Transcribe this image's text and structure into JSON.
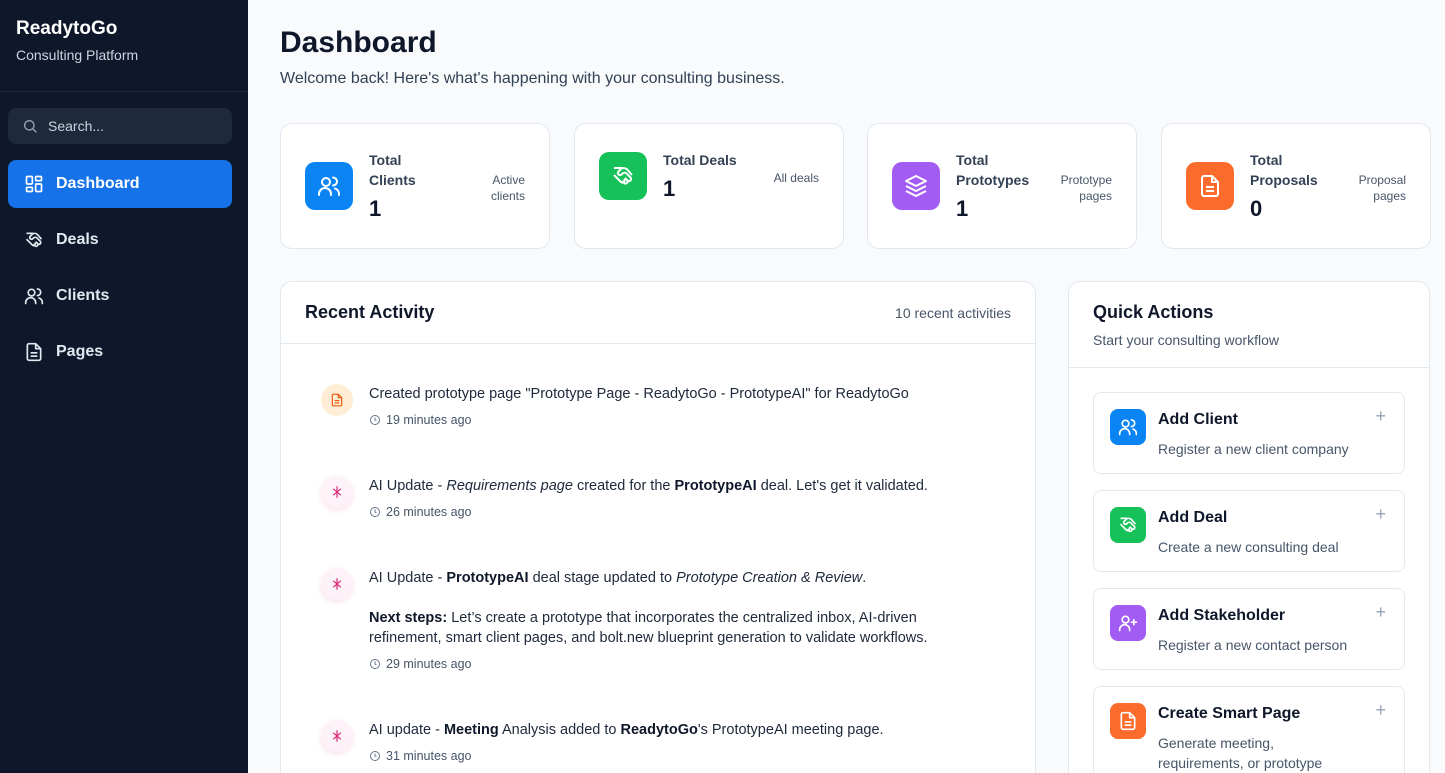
{
  "app": {
    "name": "ReadytoGo",
    "subtitle": "Consulting Platform"
  },
  "sidebar": {
    "search_placeholder": "Search...",
    "items": [
      {
        "label": "Dashboard",
        "icon": "dashboard-grid-icon",
        "active": true
      },
      {
        "label": "Deals",
        "icon": "handshake-icon"
      },
      {
        "label": "Clients",
        "icon": "users-icon"
      },
      {
        "label": "Pages",
        "icon": "document-icon"
      }
    ]
  },
  "header": {
    "title": "Dashboard",
    "subtitle": "Welcome back! Here's what's happening with your consulting business."
  },
  "stats": [
    {
      "label": "Total Clients",
      "value": "1",
      "desc": "Active clients",
      "icon": "users-icon",
      "color": "#0b84f3"
    },
    {
      "label": "Total Deals",
      "value": "1",
      "desc": "All deals",
      "icon": "handshake-icon",
      "color": "#16c15a"
    },
    {
      "label": "Total Prototypes",
      "value": "1",
      "desc": "Prototype pages",
      "icon": "layers-icon",
      "color": "#a25cf3"
    },
    {
      "label": "Total Proposals",
      "value": "0",
      "desc": "Proposal pages",
      "icon": "document-icon",
      "color": "#fb6c2c"
    }
  ],
  "recent": {
    "title": "Recent Activity",
    "count": "10 recent activities",
    "items": [
      {
        "icon": "document-icon",
        "text": "Created prototype page \"Prototype Page - ReadytoGo - PrototypeAI\" for ReadytoGo",
        "time": "19 minutes ago"
      },
      {
        "icon": "ai-sparkle-icon",
        "p1": "AI Update - ",
        "p2": "Requirements page",
        "p3": " created for the ",
        "p4": "PrototypeAI",
        "p5": " deal. Let's get it validated.",
        "time": "26 minutes ago"
      },
      {
        "icon": "ai-sparkle-icon",
        "p1": "AI Update - ",
        "p2": "PrototypeAI",
        "p3": " deal stage updated to ",
        "p4": "Prototype Creation & Review",
        "p5": ".",
        "next_label": "Next steps:",
        "next_text": " Let’s create a prototype that incorporates the centralized inbox, AI-driven refinement, smart client pages, and bolt.new blueprint generation to validate workflows.",
        "time": "29 minutes ago"
      },
      {
        "icon": "ai-sparkle-icon",
        "p1": "AI update - ",
        "p2": "Meeting",
        "p3": " Analysis added to ",
        "p4": "ReadytoGo",
        "p5": "'s PrototypeAI meeting page.",
        "time": "31 minutes ago"
      }
    ]
  },
  "quick": {
    "title": "Quick Actions",
    "subtitle": "Start your consulting workflow",
    "plus": "+",
    "items": [
      {
        "title": "Add Client",
        "desc": "Register a new client company",
        "icon": "users-icon",
        "color": "#0b84f3"
      },
      {
        "title": "Add Deal",
        "desc": "Create a new consulting deal",
        "icon": "handshake-icon",
        "color": "#16c15a"
      },
      {
        "title": "Add Stakeholder",
        "desc": "Register a new contact person",
        "icon": "user-plus-icon",
        "color": "#a25cf3"
      },
      {
        "title": "Create Smart Page",
        "desc": "Generate meeting, requirements, or prototype",
        "icon": "document-icon",
        "color": "#fb6c2c"
      }
    ]
  }
}
